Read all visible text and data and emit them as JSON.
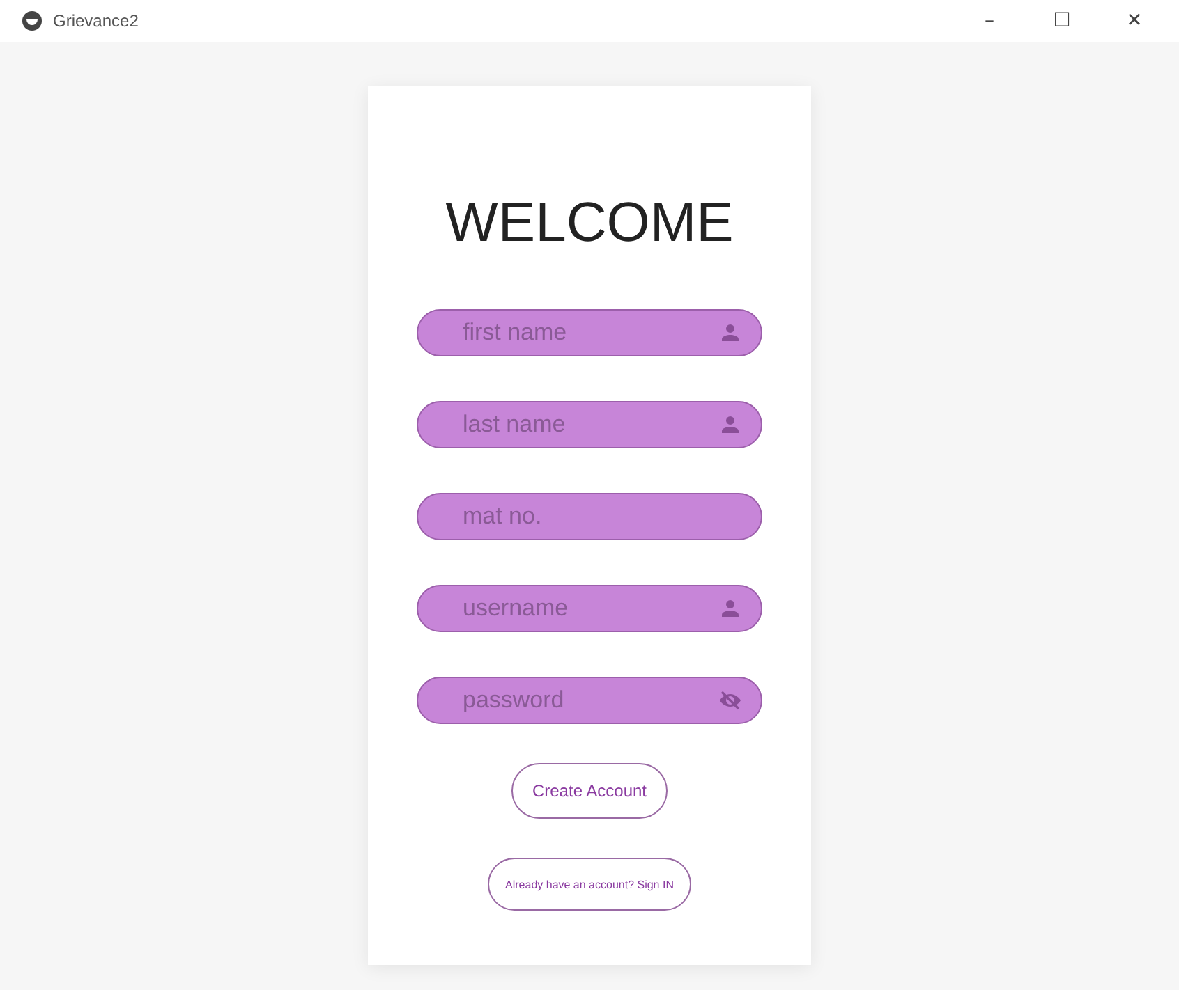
{
  "window": {
    "title": "Grievance2",
    "controls": [
      "–",
      "☐",
      "✕"
    ]
  },
  "heading": "WELCOME",
  "fields": [
    {
      "placeholder": "first name",
      "kind": "person"
    },
    {
      "placeholder": "last name",
      "kind": "person"
    },
    {
      "placeholder": "mat no.",
      "kind": "plain"
    },
    {
      "placeholder": "username",
      "kind": "person"
    },
    {
      "placeholder": "password",
      "kind": "secret"
    }
  ],
  "buttons": [
    {
      "label": "Create Account",
      "kind": "primary"
    },
    {
      "label": "Already have an account? Sign IN",
      "kind": "small"
    }
  ]
}
